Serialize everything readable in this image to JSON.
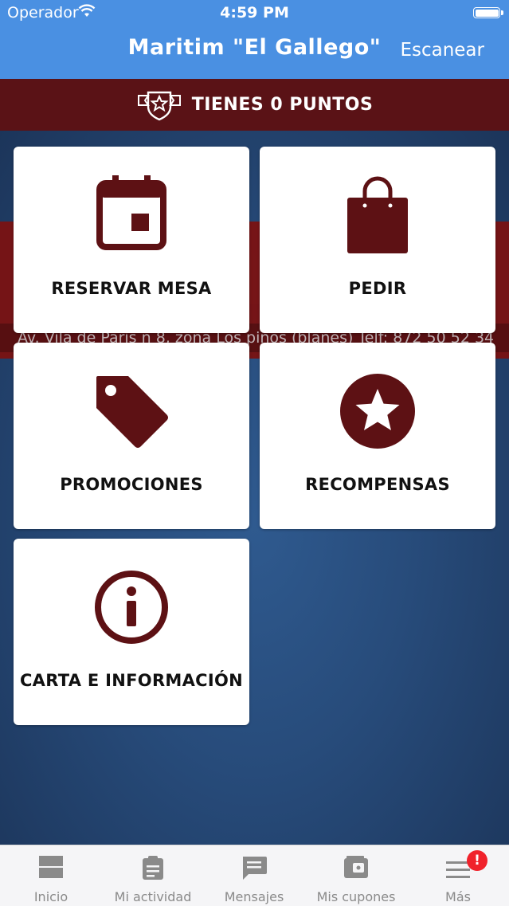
{
  "status_bar": {
    "carrier": "Operador",
    "time": "4:59 PM"
  },
  "header": {
    "title": "Maritim \"El Gallego\"",
    "scan_label": "Escanear"
  },
  "points_banner": {
    "text": "TIENES 0 PUNTOS"
  },
  "background": {
    "address_text": "Av. Vila de Paris n 8, zona Los pinos (blanes) Telf: 872 50 52 34"
  },
  "menu": {
    "reserve": "RESERVAR MESA",
    "order": "PEDIR",
    "promotions": "PROMOCIONES",
    "rewards": "RECOMPENSAS",
    "info": "CARTA E INFORMACIÓN"
  },
  "tabbar": {
    "home": "Inicio",
    "activity": "Mi actividad",
    "messages": "Mensajes",
    "coupons": "Mis cupones",
    "more": "Más",
    "more_badge": "!"
  },
  "colors": {
    "accent": "#4a90e2",
    "brand": "#5a1216",
    "icon": "#5d1114"
  }
}
